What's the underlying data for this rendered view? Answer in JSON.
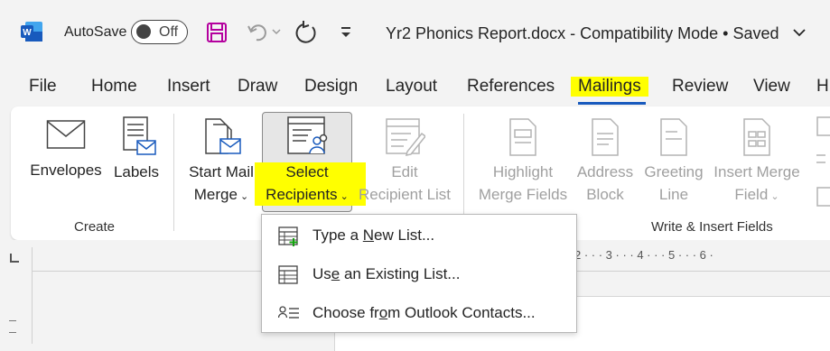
{
  "titlebar": {
    "autosave_label": "AutoSave",
    "autosave_state": "Off",
    "document_title": "Yr2 Phonics Report.docx  -  Compatibility Mode • Saved"
  },
  "tabs": [
    "File",
    "Home",
    "Insert",
    "Draw",
    "Design",
    "Layout",
    "References",
    "Mailings",
    "Review",
    "View",
    "H"
  ],
  "active_tab": "Mailings",
  "ribbon": {
    "create_group": {
      "label": "Create",
      "envelopes": "Envelopes",
      "labels": "Labels"
    },
    "start_mail_merge": {
      "line1": "Start Mail",
      "line2": "Merge"
    },
    "select_recipients": {
      "line1": "Select",
      "line2": "Recipients"
    },
    "edit_recipient_list": {
      "line1": "Edit",
      "line2": "Recipient List"
    },
    "write_insert_group": {
      "label": "Write & Insert Fields",
      "highlight_merge_fields": {
        "line1": "Highlight",
        "line2": "Merge Fields"
      },
      "address_block": {
        "line1": "Address",
        "line2": "Block"
      },
      "greeting_line": {
        "line1": "Greeting",
        "line2": "Line"
      },
      "insert_merge_field": {
        "line1": "Insert Merge",
        "line2": "Field"
      }
    }
  },
  "ruler": {
    "numbers": "2 · · · 3 · · · 4 · · · 5 · · · 6 ·"
  },
  "dropdown": {
    "items": [
      {
        "pre": "Type a ",
        "key": "N",
        "post": "ew List..."
      },
      {
        "pre": "Us",
        "key": "e",
        "post": " an Existing List..."
      },
      {
        "pre": "Choose fr",
        "key": "o",
        "post": "m Outlook Contacts..."
      }
    ]
  },
  "colors": {
    "accent": "#185abd",
    "highlight": "#ffff00",
    "word_blue": "#185abd",
    "save_icon": "#b4009e"
  }
}
